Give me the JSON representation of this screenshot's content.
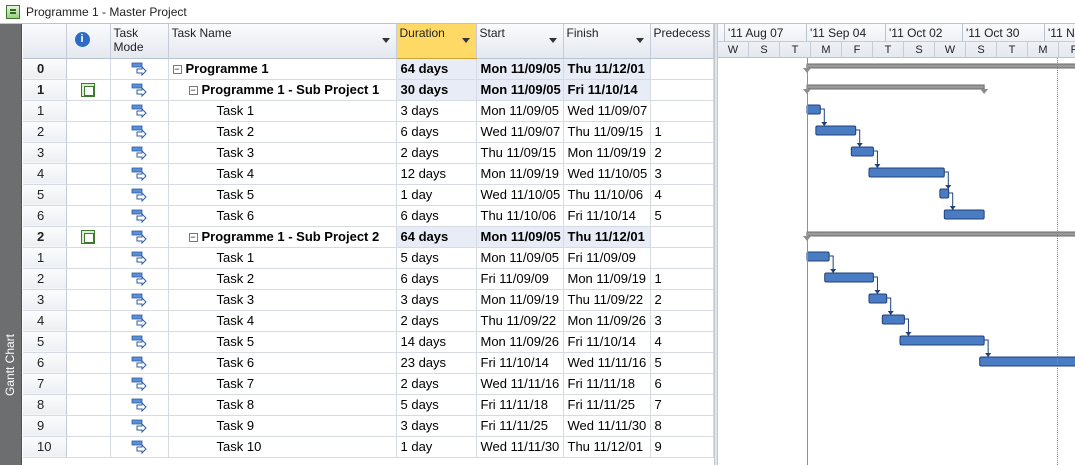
{
  "window": {
    "title": "Programme 1 - Master Project"
  },
  "sidebar": {
    "label": "Gantt Chart"
  },
  "columns": {
    "task_mode": "Task Mode",
    "task_name": "Task Name",
    "duration": "Duration",
    "start": "Start",
    "finish": "Finish",
    "predecessors": "Predecess"
  },
  "rows": [
    {
      "id": "0",
      "indicator": "",
      "name": "Programme 1",
      "level": 0,
      "summary": true,
      "duration": "64 days",
      "start": "Mon 11/09/05",
      "finish": "Thu 11/12/01",
      "pred": ""
    },
    {
      "id": "1",
      "indicator": "inserted-project-icon",
      "name": "Programme 1 - Sub Project 1",
      "level": 1,
      "summary": true,
      "duration": "30 days",
      "start": "Mon 11/09/05",
      "finish": "Fri 11/10/14",
      "pred": ""
    },
    {
      "id": "1",
      "indicator": "",
      "name": "Task 1",
      "level": 2,
      "summary": false,
      "duration": "3 days",
      "start": "Mon 11/09/05",
      "finish": "Wed 11/09/07",
      "pred": ""
    },
    {
      "id": "2",
      "indicator": "",
      "name": "Task 2",
      "level": 2,
      "summary": false,
      "duration": "6 days",
      "start": "Wed 11/09/07",
      "finish": "Thu 11/09/15",
      "pred": "1"
    },
    {
      "id": "3",
      "indicator": "",
      "name": "Task 3",
      "level": 2,
      "summary": false,
      "duration": "2 days",
      "start": "Thu 11/09/15",
      "finish": "Mon 11/09/19",
      "pred": "2"
    },
    {
      "id": "4",
      "indicator": "",
      "name": "Task 4",
      "level": 2,
      "summary": false,
      "duration": "12 days",
      "start": "Mon 11/09/19",
      "finish": "Wed 11/10/05",
      "pred": "3"
    },
    {
      "id": "5",
      "indicator": "",
      "name": "Task 5",
      "level": 2,
      "summary": false,
      "duration": "1 day",
      "start": "Wed 11/10/05",
      "finish": "Thu 11/10/06",
      "pred": "4"
    },
    {
      "id": "6",
      "indicator": "",
      "name": "Task 6",
      "level": 2,
      "summary": false,
      "duration": "6 days",
      "start": "Thu 11/10/06",
      "finish": "Fri 11/10/14",
      "pred": "5"
    },
    {
      "id": "2",
      "indicator": "inserted-project-icon",
      "name": "Programme 1 - Sub Project 2",
      "level": 1,
      "summary": true,
      "duration": "64 days",
      "start": "Mon 11/09/05",
      "finish": "Thu 11/12/01",
      "pred": ""
    },
    {
      "id": "1",
      "indicator": "",
      "name": "Task  1",
      "level": 2,
      "summary": false,
      "duration": "5 days",
      "start": "Mon 11/09/05",
      "finish": "Fri 11/09/09",
      "pred": ""
    },
    {
      "id": "2",
      "indicator": "",
      "name": "Task 2",
      "level": 2,
      "summary": false,
      "duration": "6 days",
      "start": "Fri 11/09/09",
      "finish": "Mon 11/09/19",
      "pred": "1"
    },
    {
      "id": "3",
      "indicator": "",
      "name": "Task 3",
      "level": 2,
      "summary": false,
      "duration": "3 days",
      "start": "Mon 11/09/19",
      "finish": "Thu 11/09/22",
      "pred": "2"
    },
    {
      "id": "4",
      "indicator": "",
      "name": "Task 4",
      "level": 2,
      "summary": false,
      "duration": "2 days",
      "start": "Thu 11/09/22",
      "finish": "Mon 11/09/26",
      "pred": "3"
    },
    {
      "id": "5",
      "indicator": "",
      "name": "Task 5",
      "level": 2,
      "summary": false,
      "duration": "14 days",
      "start": "Mon 11/09/26",
      "finish": "Fri 11/10/14",
      "pred": "4"
    },
    {
      "id": "6",
      "indicator": "",
      "name": "Task 6",
      "level": 2,
      "summary": false,
      "duration": "23 days",
      "start": "Fri 11/10/14",
      "finish": "Wed 11/11/16",
      "pred": "5"
    },
    {
      "id": "7",
      "indicator": "",
      "name": "Task 7",
      "level": 2,
      "summary": false,
      "duration": "2 days",
      "start": "Wed 11/11/16",
      "finish": "Fri 11/11/18",
      "pred": "6"
    },
    {
      "id": "8",
      "indicator": "",
      "name": "Task 8",
      "level": 2,
      "summary": false,
      "duration": "5 days",
      "start": "Fri 11/11/18",
      "finish": "Fri 11/11/25",
      "pred": "7"
    },
    {
      "id": "9",
      "indicator": "",
      "name": "Task 9",
      "level": 2,
      "summary": false,
      "duration": "3 days",
      "start": "Fri 11/11/25",
      "finish": "Wed 11/11/30",
      "pred": "8"
    },
    {
      "id": "10",
      "indicator": "",
      "name": "Task 10",
      "level": 2,
      "summary": false,
      "duration": "1 day",
      "start": "Wed 11/11/30",
      "finish": "Thu 11/12/01",
      "pred": "9"
    }
  ],
  "timescale": {
    "weeks": [
      "'11 Aug 07",
      "'11 Sep 04",
      "'11 Oct 02",
      "'11 Oct 30",
      "'11 N"
    ],
    "days": [
      "W",
      "S",
      "T",
      "M",
      "F",
      "T",
      "S",
      "W",
      "S",
      "T",
      "M",
      "F"
    ]
  },
  "colors": {
    "accent": "#ffd966",
    "bar": "#4a7cc4",
    "summary": "#8c8c8c",
    "today": "#e07a2e"
  }
}
